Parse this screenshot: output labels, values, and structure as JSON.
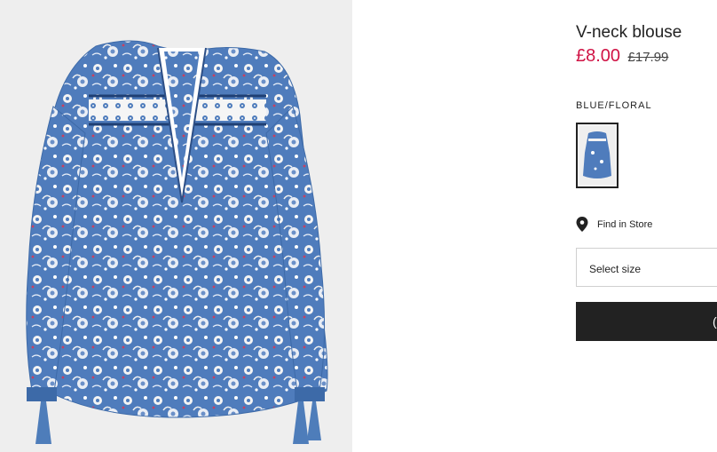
{
  "product": {
    "title": "V-neck blouse",
    "price_sale": "£8.00",
    "price_original": "£17.99",
    "price_sale_color": "#d01345"
  },
  "color": {
    "label": "BLUE/FLORAL",
    "swatch_selected": true
  },
  "store": {
    "label": "Find in Store",
    "icon": "location-pin-icon"
  },
  "size_select": {
    "value": "Select size"
  },
  "add_button": {
    "label_partial": "("
  },
  "colors": {
    "fabric": "#4f7cbc",
    "background": "#eeeeee",
    "button": "#222222"
  }
}
